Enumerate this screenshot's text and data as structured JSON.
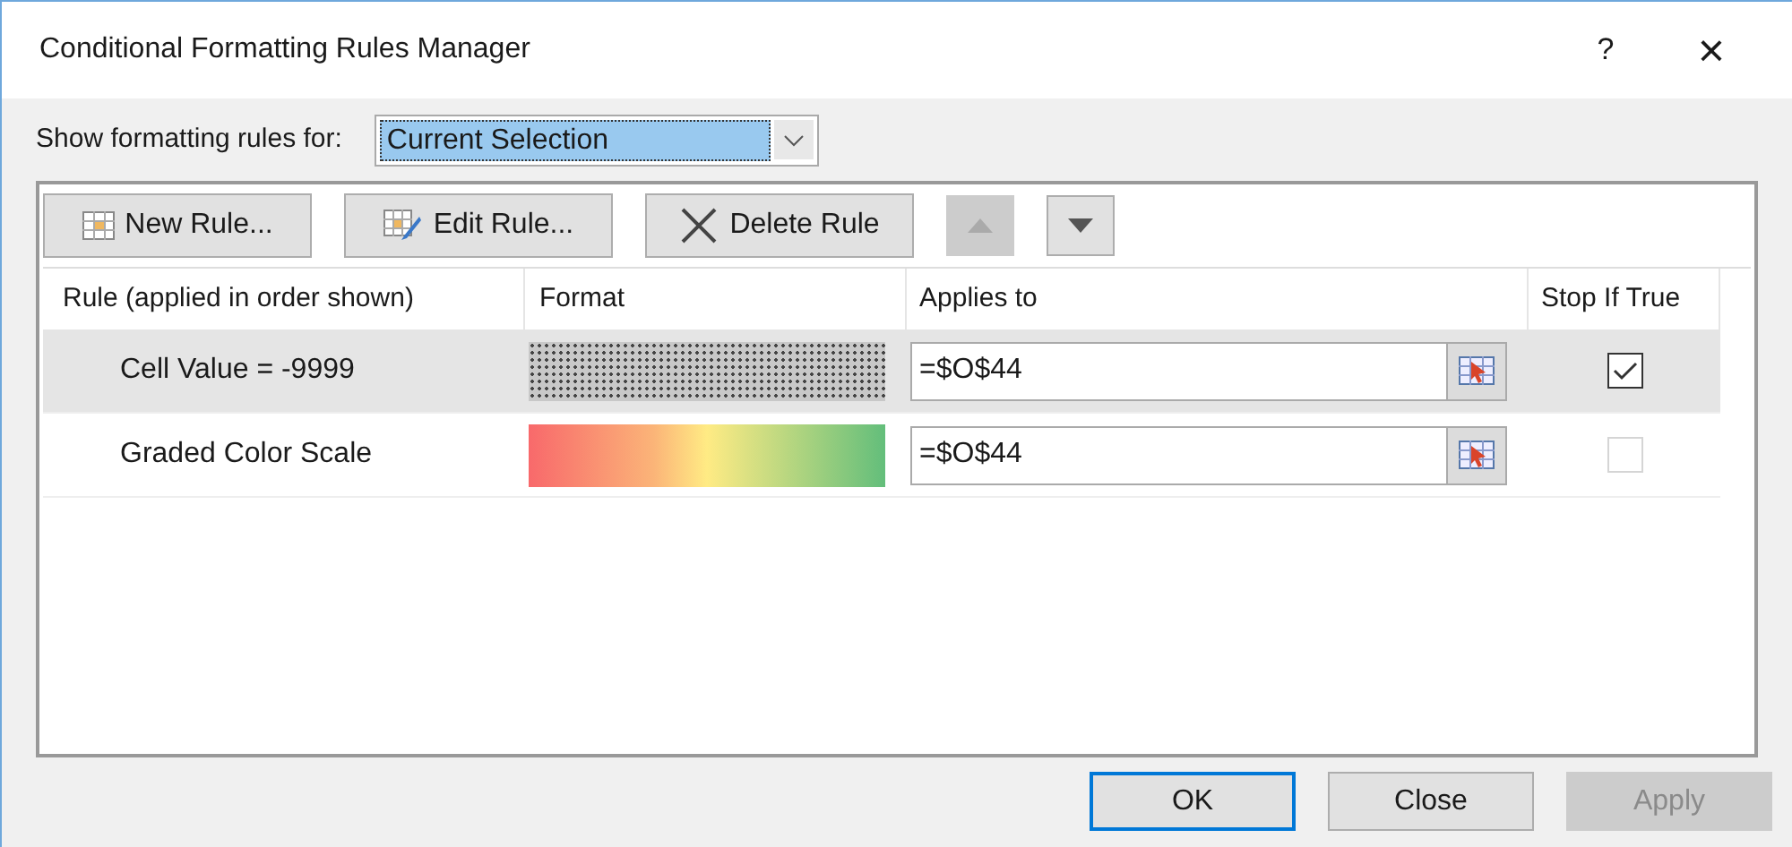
{
  "window": {
    "title": "Conditional Formatting Rules Manager",
    "help": "?",
    "close": "×"
  },
  "show_rules_for": {
    "label": "Show formatting rules for:",
    "value": "Current Selection"
  },
  "toolbar": [
    {
      "kind": "new",
      "label": "New Rule...",
      "disabled": false
    },
    {
      "kind": "edit",
      "label": "Edit Rule...",
      "disabled": false
    },
    {
      "kind": "delete",
      "label": "Delete Rule",
      "disabled": false
    },
    {
      "kind": "up",
      "disabled": true
    },
    {
      "kind": "down",
      "disabled": false
    }
  ],
  "table": {
    "columns": [
      "Rule (applied in order shown)",
      "Format",
      "Applies to",
      "Stop If True"
    ],
    "rows": [
      {
        "rule": "Cell Value = -9999",
        "format": {
          "kind": "pattern"
        },
        "applies_to": "=$O$44",
        "stop_if_true": true,
        "stop_disabled": false,
        "selected": true
      },
      {
        "rule": "Graded Color Scale",
        "format": {
          "kind": "gradient"
        },
        "applies_to": "=$O$44",
        "stop_if_true": false,
        "stop_disabled": true,
        "selected": false
      }
    ]
  },
  "buttons": [
    {
      "label": "OK",
      "default": true,
      "disabled": false
    },
    {
      "label": "Close",
      "default": false,
      "disabled": false
    },
    {
      "label": "Apply",
      "default": false,
      "disabled": true
    }
  ]
}
